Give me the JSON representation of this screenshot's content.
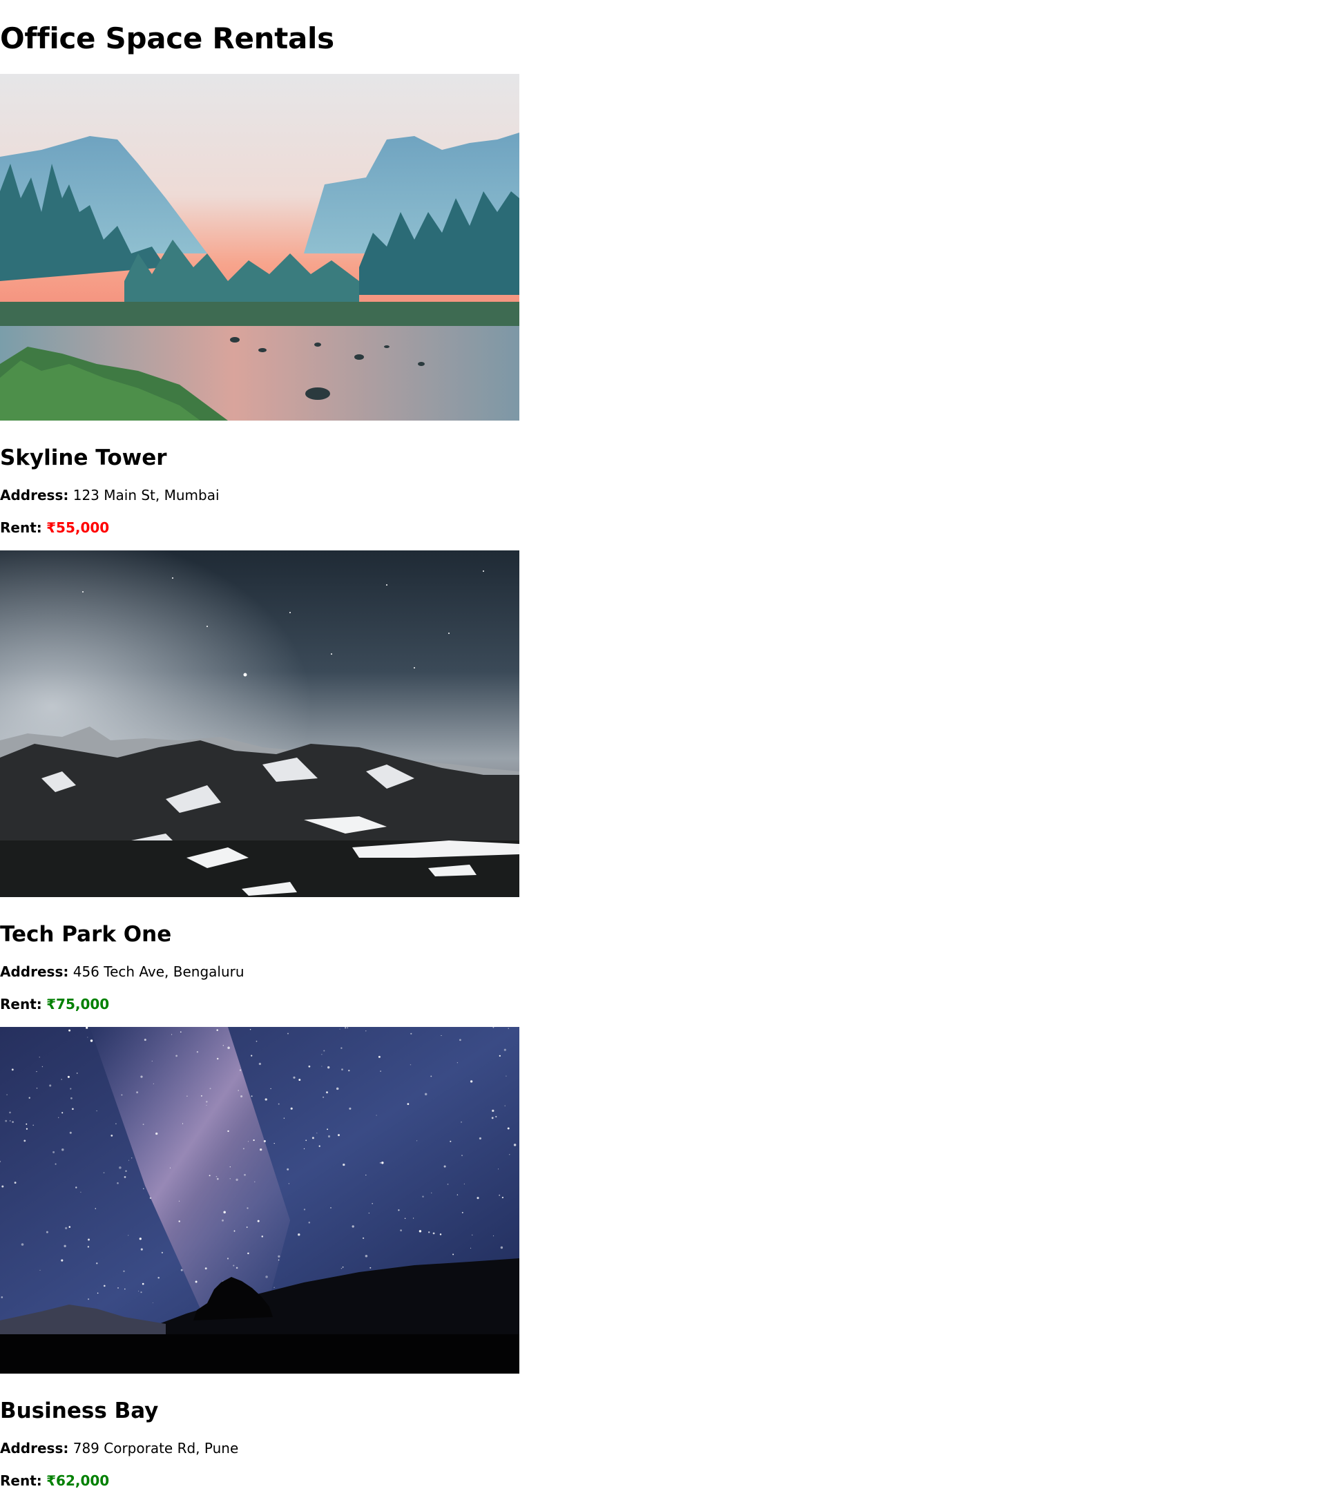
{
  "page": {
    "title": "Office Space Rentals"
  },
  "labels": {
    "address": "Address:",
    "rent": "Rent:"
  },
  "colors": {
    "rent_high": "#ff0000",
    "rent_ok": "#008000"
  },
  "listings": [
    {
      "name": "Skyline Tower",
      "address": "123 Main St, Mumbai",
      "rent": "₹55,000",
      "rent_color": "#ff0000",
      "photo": "mountain-valley-river-photo"
    },
    {
      "name": "Tech Park One",
      "address": "456 Tech Ave, Bengaluru",
      "rent": "₹75,000",
      "rent_color": "#008000",
      "photo": "snowy-mountains-night-photo"
    },
    {
      "name": "Business Bay",
      "address": "789 Corporate Rd, Pune",
      "rent": "₹62,000",
      "rent_color": "#008000",
      "photo": "milky-way-night-sky-photo"
    }
  ]
}
